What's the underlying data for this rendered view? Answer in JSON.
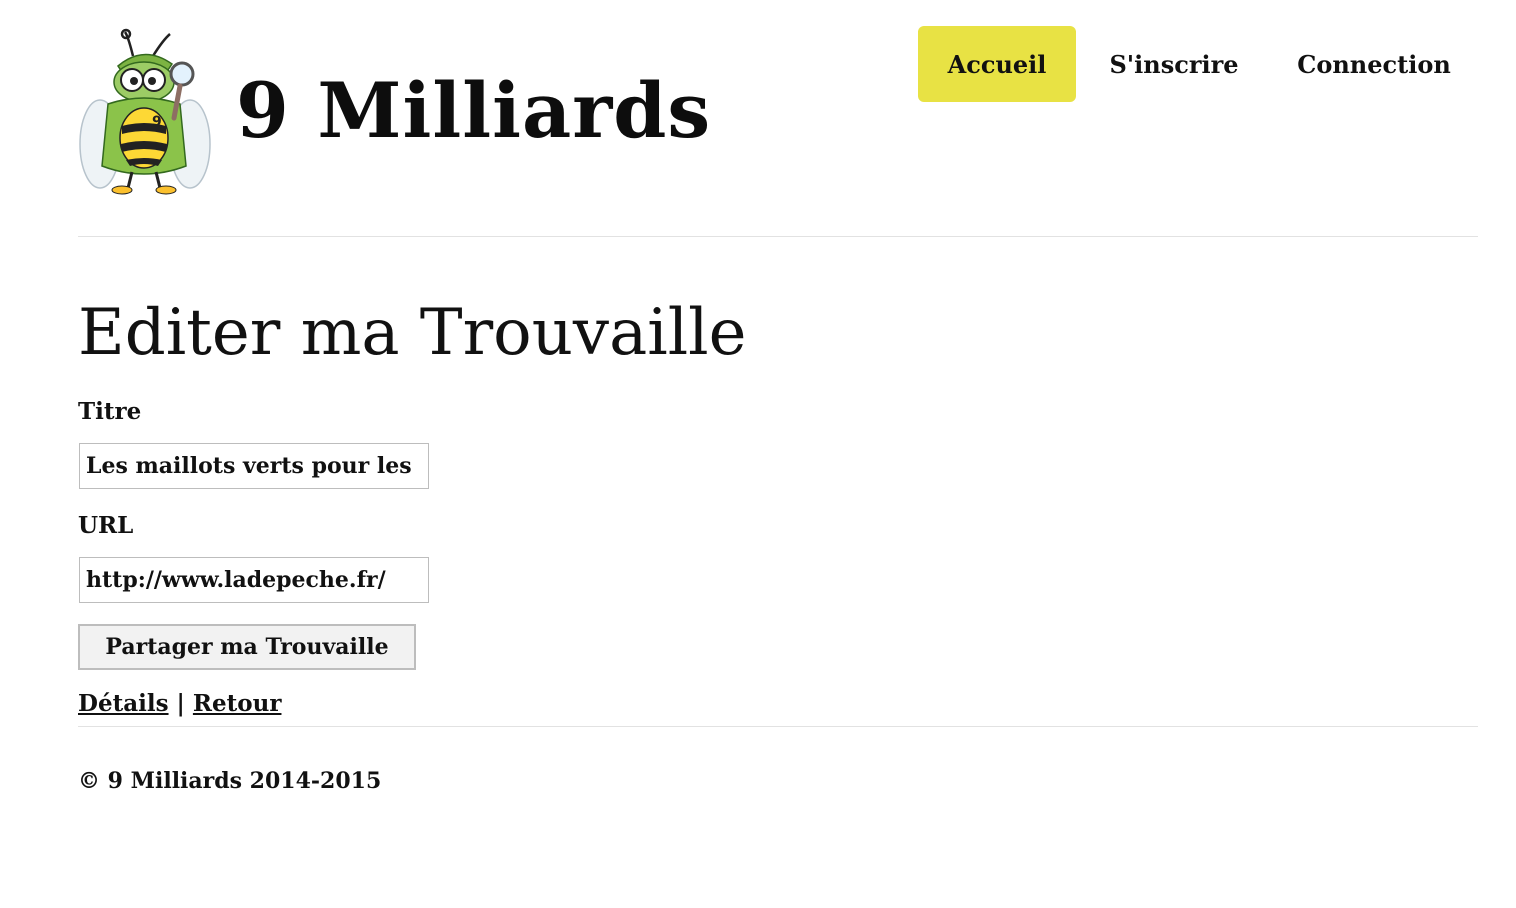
{
  "header": {
    "site_title": "9 Milliards",
    "logo_icon": "bee-detective-logo-icon"
  },
  "nav": {
    "items": [
      {
        "label": "Accueil",
        "active": true
      },
      {
        "label": "S'inscrire",
        "active": false
      },
      {
        "label": "Connection",
        "active": false
      }
    ],
    "active_color": "#e8e244"
  },
  "main": {
    "heading": "Editer ma Trouvaille",
    "fields": {
      "titre": {
        "label": "Titre",
        "value": "Les maillots verts pour les"
      },
      "url": {
        "label": "URL",
        "value": "http://www.ladepeche.fr/"
      }
    },
    "submit_label": "Partager ma Trouvaille",
    "links": {
      "details": "Détails",
      "separator": "|",
      "back": "Retour"
    }
  },
  "footer": {
    "copyright": "© 9 Milliards 2014-2015"
  }
}
